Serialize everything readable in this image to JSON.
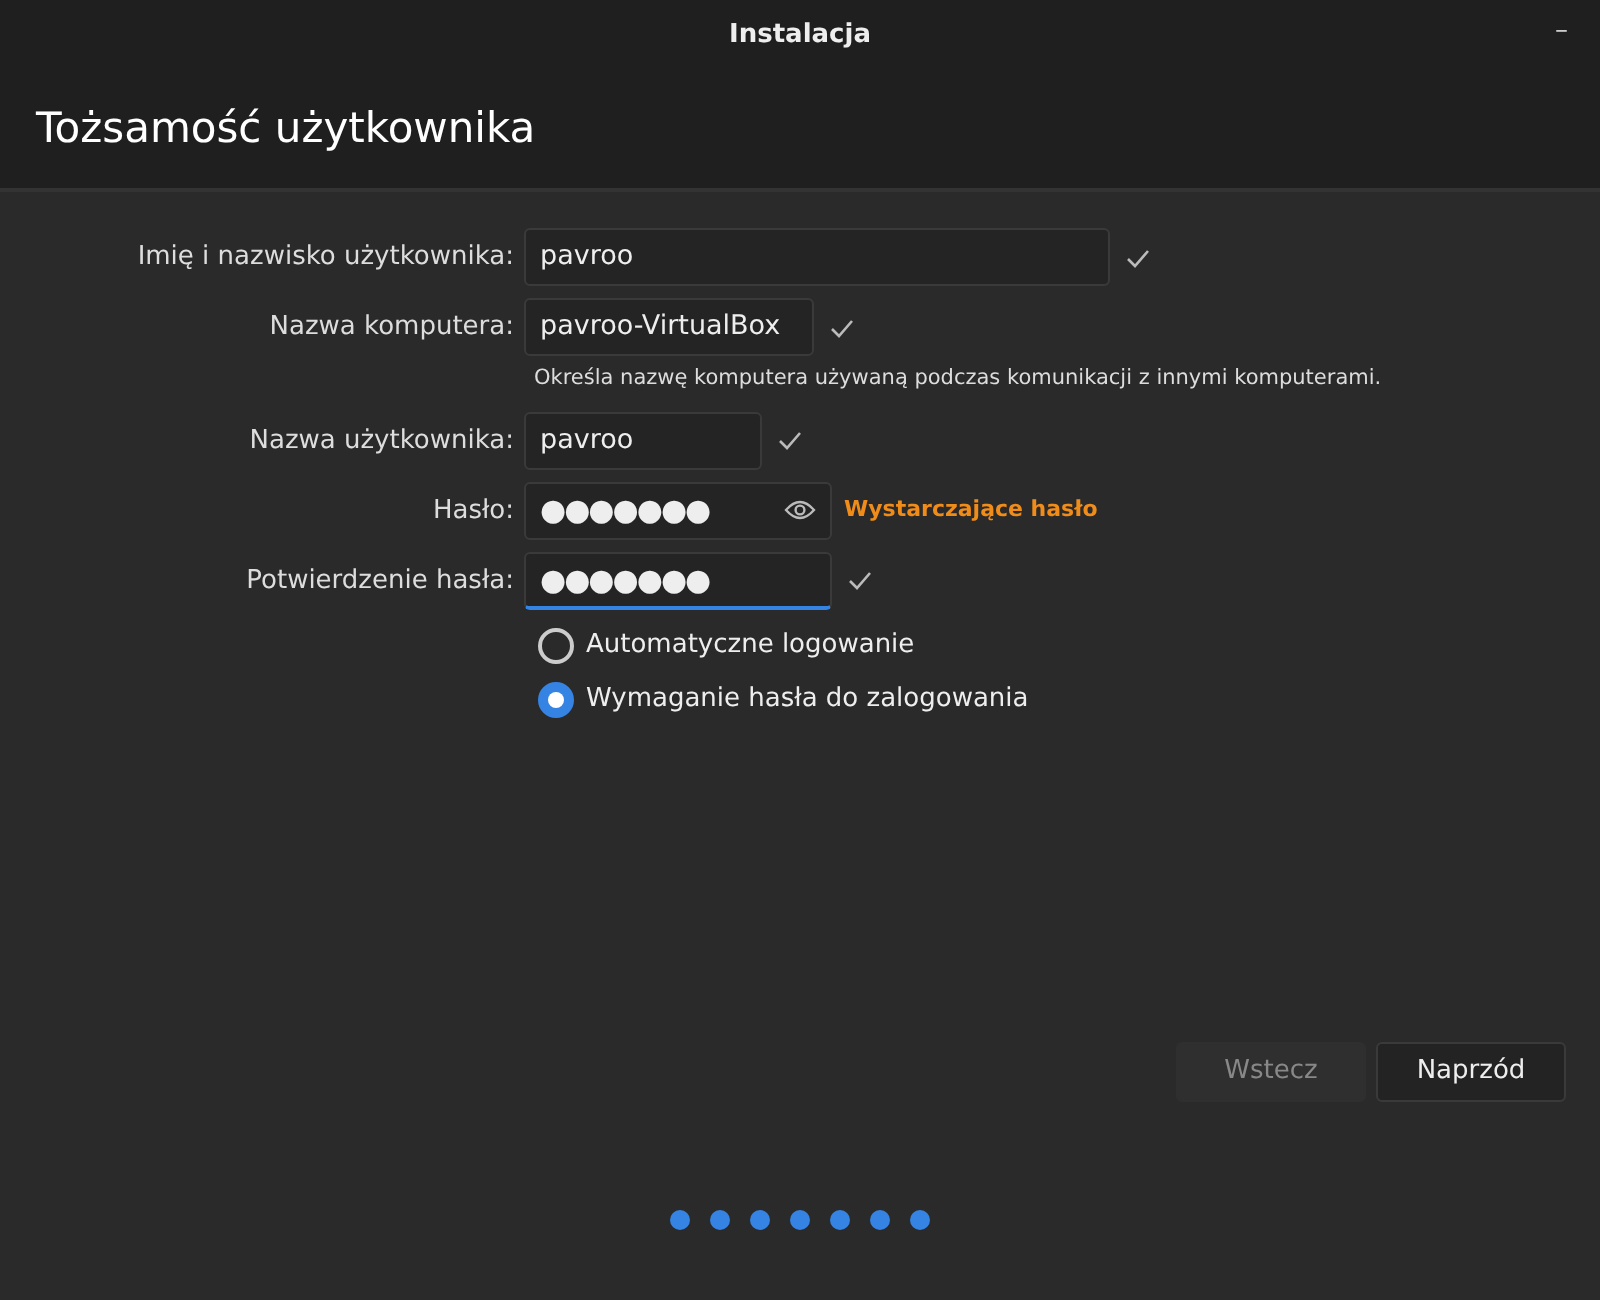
{
  "window": {
    "title": "Instalacja",
    "minimize": "–"
  },
  "page_title": "Tożsamość użytkownika",
  "fields": [
    {
      "label": "Imię i nazwisko użytkownika:",
      "value": "pavroo",
      "kind": "text",
      "valid": true,
      "focused": false
    },
    {
      "label": "Nazwa komputera:",
      "value": "pavroo-VirtualBox",
      "kind": "text",
      "valid": true,
      "focused": false,
      "hint": "Określa nazwę komputera używaną podczas komunikacji z innymi komputerami."
    },
    {
      "label": "Nazwa użytkownika:",
      "value": "pavroo",
      "kind": "text",
      "valid": true,
      "focused": false
    },
    {
      "label": "Hasło:",
      "value": "●●●●●●●",
      "kind": "password",
      "valid": false,
      "focused": false,
      "strength": "Wystarczające hasło"
    },
    {
      "label": "Potwierdzenie hasła:",
      "value": "●●●●●●●",
      "kind": "text",
      "valid": true,
      "focused": true
    }
  ],
  "login_options": [
    {
      "label": "Automatyczne logowanie",
      "selected": false
    },
    {
      "label": "Wymaganie hasła do zalogowania",
      "selected": true
    }
  ],
  "buttons": [
    {
      "label": "Wstecz",
      "disabled": true
    },
    {
      "label": "Naprzód",
      "disabled": false
    }
  ],
  "steps": [
    {
      "done": true
    },
    {
      "done": true
    },
    {
      "done": true
    },
    {
      "done": true
    },
    {
      "done": true
    },
    {
      "done": true
    },
    {
      "done": true
    }
  ]
}
